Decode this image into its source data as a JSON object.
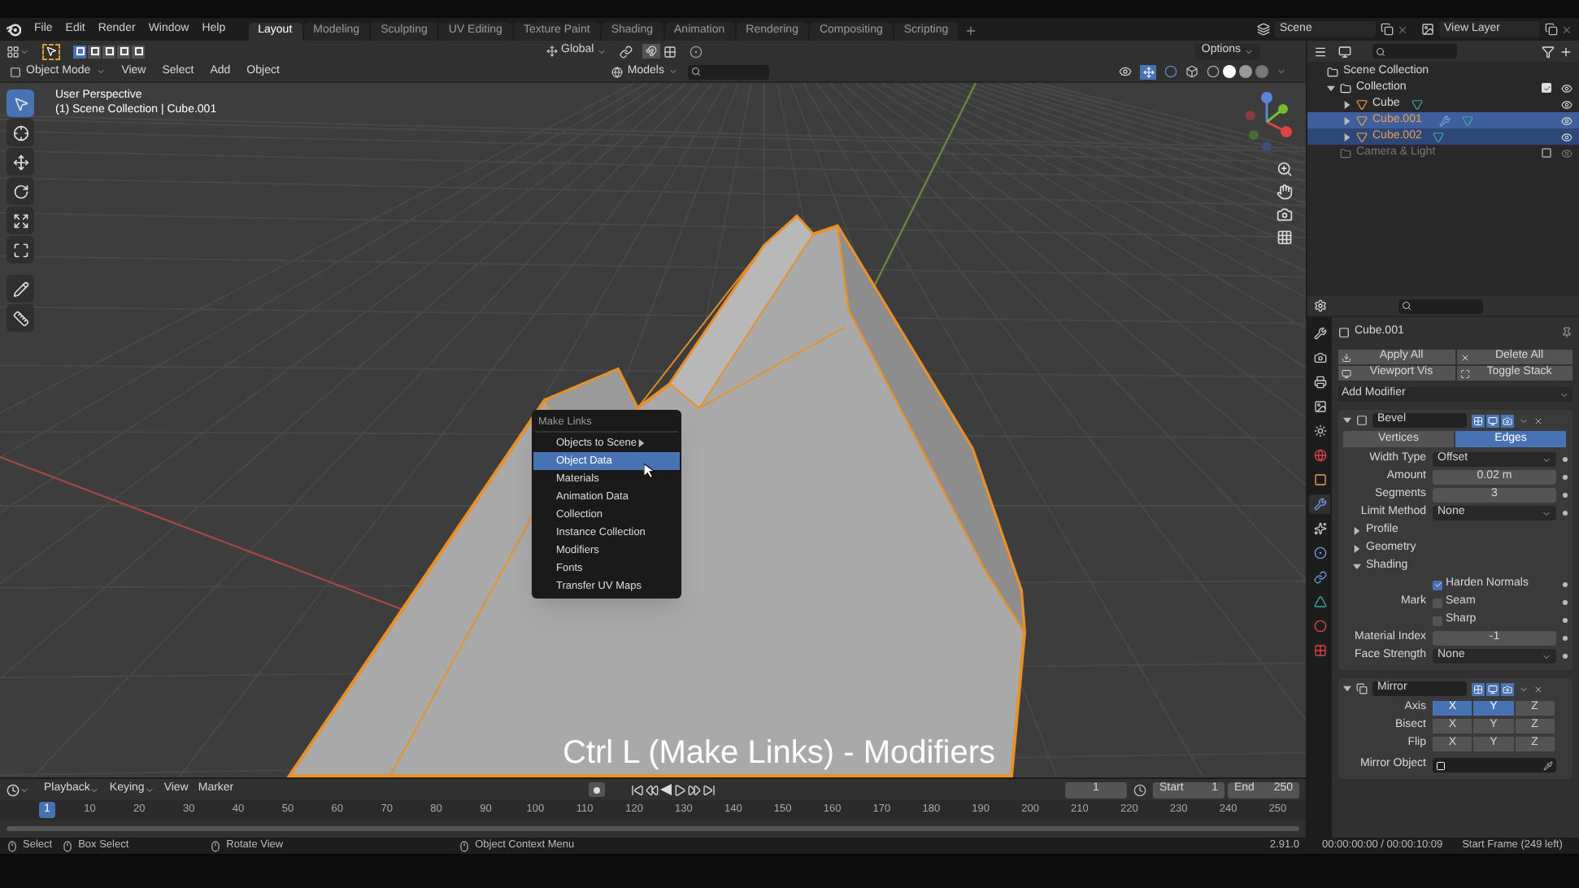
{
  "menubar": {
    "menus": [
      "File",
      "Edit",
      "Render",
      "Window",
      "Help"
    ]
  },
  "workspaces": [
    {
      "label": "Layout",
      "selected": true
    },
    {
      "label": "Modeling",
      "selected": false
    },
    {
      "label": "Sculpting",
      "selected": false
    },
    {
      "label": "UV Editing",
      "selected": false
    },
    {
      "label": "Texture Paint",
      "selected": false
    },
    {
      "label": "Shading",
      "selected": false
    },
    {
      "label": "Animation",
      "selected": false
    },
    {
      "label": "Rendering",
      "selected": false
    },
    {
      "label": "Compositing",
      "selected": false
    },
    {
      "label": "Scripting",
      "selected": false
    }
  ],
  "scene": {
    "name": "Scene"
  },
  "view_layer": {
    "name": "View Layer"
  },
  "tool_header": {
    "select_modes": [
      {
        "selected": true
      },
      {
        "selected": false
      },
      {
        "selected": false
      },
      {
        "selected": false
      },
      {
        "selected": false
      }
    ],
    "orientation": "Global",
    "options": "Options"
  },
  "viewport_header": {
    "mode": "Object Mode",
    "menus": [
      "View",
      "Select",
      "Add",
      "Object"
    ],
    "layer_filter": "Models"
  },
  "viewport": {
    "view_name": "User Perspective",
    "context": "(1) Scene Collection | Cube.001",
    "caption": "Ctrl L (Make Links) - Modifiers",
    "tools": [
      {
        "selected": true
      },
      {
        "selected": false
      },
      {
        "selected": false
      },
      {
        "selected": false
      },
      {
        "selected": false
      },
      {
        "selected": false
      },
      {
        "selected": false
      },
      {
        "selected": false
      }
    ]
  },
  "context_menu": {
    "title": "Make Links",
    "items": [
      {
        "label": "Objects to Scene",
        "submenu": true,
        "selected": false
      },
      {
        "label": "Object Data",
        "submenu": false,
        "selected": true
      },
      {
        "label": "Materials",
        "submenu": false,
        "selected": false
      },
      {
        "label": "Animation Data",
        "submenu": false,
        "selected": false
      },
      {
        "label": "Collection",
        "submenu": false,
        "selected": false
      },
      {
        "label": "Instance Collection",
        "submenu": false,
        "selected": false
      },
      {
        "label": "Modifiers",
        "submenu": false,
        "selected": false
      },
      {
        "label": "Fonts",
        "submenu": false,
        "selected": false
      },
      {
        "label": "Transfer UV Maps",
        "submenu": false,
        "selected": false
      }
    ]
  },
  "outliner": {
    "root": "Scene Collection",
    "items": [
      {
        "label": "Collection",
        "kind": "collection",
        "expanded": true,
        "checked": true,
        "excluded": false,
        "children": [
          {
            "label": "Cube",
            "kind": "object",
            "expanded": false,
            "selected": false,
            "active": false,
            "modifier": false
          },
          {
            "label": "Cube.001",
            "kind": "object",
            "expanded": false,
            "selected": true,
            "active": true,
            "modifier": true
          },
          {
            "label": "Cube.002",
            "kind": "object",
            "expanded": false,
            "selected": true,
            "active": false,
            "modifier": false
          }
        ]
      },
      {
        "label": "Camera & Light",
        "kind": "collection",
        "checked": false,
        "excluded": true
      }
    ]
  },
  "properties": {
    "tabs": [
      {
        "selected": false
      },
      {
        "selected": false
      },
      {
        "selected": false
      },
      {
        "selected": false
      },
      {
        "selected": false
      },
      {
        "selected": false
      },
      {
        "selected": false
      },
      {
        "selected": true
      },
      {
        "selected": false
      },
      {
        "selected": false
      },
      {
        "selected": false
      },
      {
        "selected": false
      },
      {
        "selected": false
      },
      {
        "selected": false
      }
    ],
    "object": "Cube.001",
    "buttons": [
      {
        "label": "Apply All"
      },
      {
        "label": "Delete All"
      },
      {
        "label": "Viewport Vis"
      },
      {
        "label": "Toggle Stack"
      }
    ],
    "add_modifier": "Add Modifier",
    "modifiers": [
      {
        "kind": "bevel",
        "name": "Bevel",
        "expanded": true,
        "rows": [
          {
            "kind": "tabs",
            "options": [
              {
                "label": "Vertices",
                "selected": false
              },
              {
                "label": "Edges",
                "selected": true
              }
            ]
          },
          {
            "kind": "dropdown",
            "label": "Width Type",
            "value": "Offset"
          },
          {
            "kind": "number",
            "label": "Amount",
            "value": "0.02 m"
          },
          {
            "kind": "number",
            "label": "Segments",
            "value": "3"
          },
          {
            "kind": "dropdown",
            "label": "Limit Method",
            "value": "None"
          },
          {
            "kind": "panel",
            "label": "Profile",
            "expanded": false
          },
          {
            "kind": "panel",
            "label": "Geometry",
            "expanded": false
          },
          {
            "kind": "panel",
            "label": "Shading",
            "expanded": true
          },
          {
            "kind": "checkbox",
            "label": "Harden Normals",
            "checked": true
          },
          {
            "kind": "checkbox",
            "prefix": "Mark",
            "label": "Seam",
            "checked": false
          },
          {
            "kind": "checkbox",
            "label": "Sharp",
            "checked": false
          },
          {
            "kind": "number",
            "label": "Material Index",
            "value": "-1"
          },
          {
            "kind": "dropdown",
            "label": "Face Strength",
            "value": "None"
          }
        ]
      },
      {
        "kind": "mirror",
        "name": "Mirror",
        "expanded": true,
        "rows": [
          {
            "kind": "axes",
            "label": "Axis",
            "options": [
              {
                "label": "X",
                "selected": true
              },
              {
                "label": "Y",
                "selected": true
              },
              {
                "label": "Z",
                "selected": false
              }
            ]
          },
          {
            "kind": "axes",
            "label": "Bisect",
            "options": [
              {
                "label": "X",
                "selected": false
              },
              {
                "label": "Y",
                "selected": false
              },
              {
                "label": "Z",
                "selected": false
              }
            ]
          },
          {
            "kind": "axes",
            "label": "Flip",
            "options": [
              {
                "label": "X",
                "selected": false
              },
              {
                "label": "Y",
                "selected": false
              },
              {
                "label": "Z",
                "selected": false
              }
            ]
          },
          {
            "kind": "object",
            "label": "Mirror Object"
          }
        ]
      }
    ]
  },
  "timeline": {
    "menus": [
      {
        "label": "Playback",
        "dropdown": true
      },
      {
        "label": "Keying",
        "dropdown": true
      },
      {
        "label": "View",
        "dropdown": false
      },
      {
        "label": "Marker",
        "dropdown": false
      }
    ],
    "current_frame": "1",
    "start_label": "Start",
    "start": "1",
    "end_label": "End",
    "end": "250",
    "playhead": "1",
    "ruler": [
      "10",
      "20",
      "30",
      "40",
      "50",
      "60",
      "70",
      "80",
      "90",
      "100",
      "110",
      "120",
      "130",
      "140",
      "150",
      "160",
      "170",
      "180",
      "190",
      "200",
      "210",
      "220",
      "230",
      "240",
      "250"
    ]
  },
  "status_bar": {
    "hints": [
      "Select",
      "Box Select",
      "Rotate View",
      "Object Context Menu"
    ],
    "version": "2.91.0",
    "time": "00:00:00:00 / 00:00:10:09",
    "frames": "Start Frame (249 left)"
  }
}
